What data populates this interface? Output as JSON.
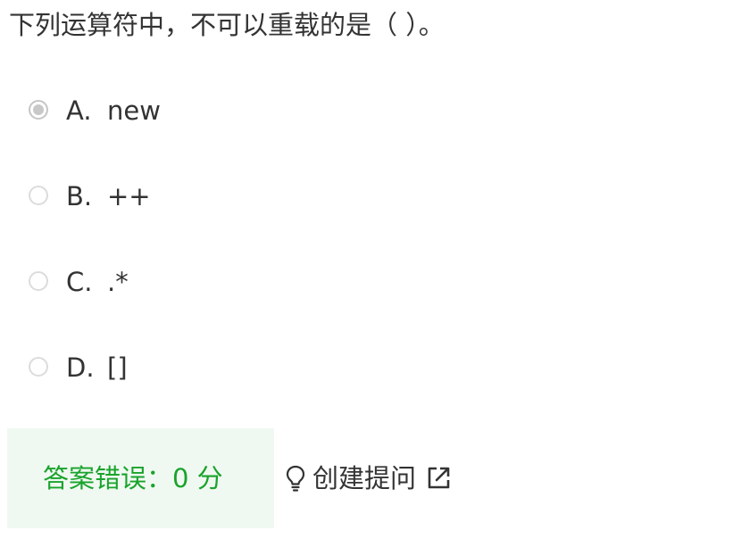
{
  "question": {
    "text": "下列运算符中，不可以重载的是（ ）。"
  },
  "options": [
    {
      "letter": "A.",
      "text": "new",
      "selected": true
    },
    {
      "letter": "B.",
      "text": "++",
      "selected": false
    },
    {
      "letter": "C.",
      "text": ".*",
      "selected": false
    },
    {
      "letter": "D.",
      "text": "[]",
      "selected": false
    }
  ],
  "result": {
    "text": "答案错误：0 分",
    "color": "#19a32c",
    "background": "#f0f9f1"
  },
  "hint": {
    "label": "创建提问",
    "icon": "lightbulb-icon",
    "trailing_icon": "external-link-icon"
  }
}
